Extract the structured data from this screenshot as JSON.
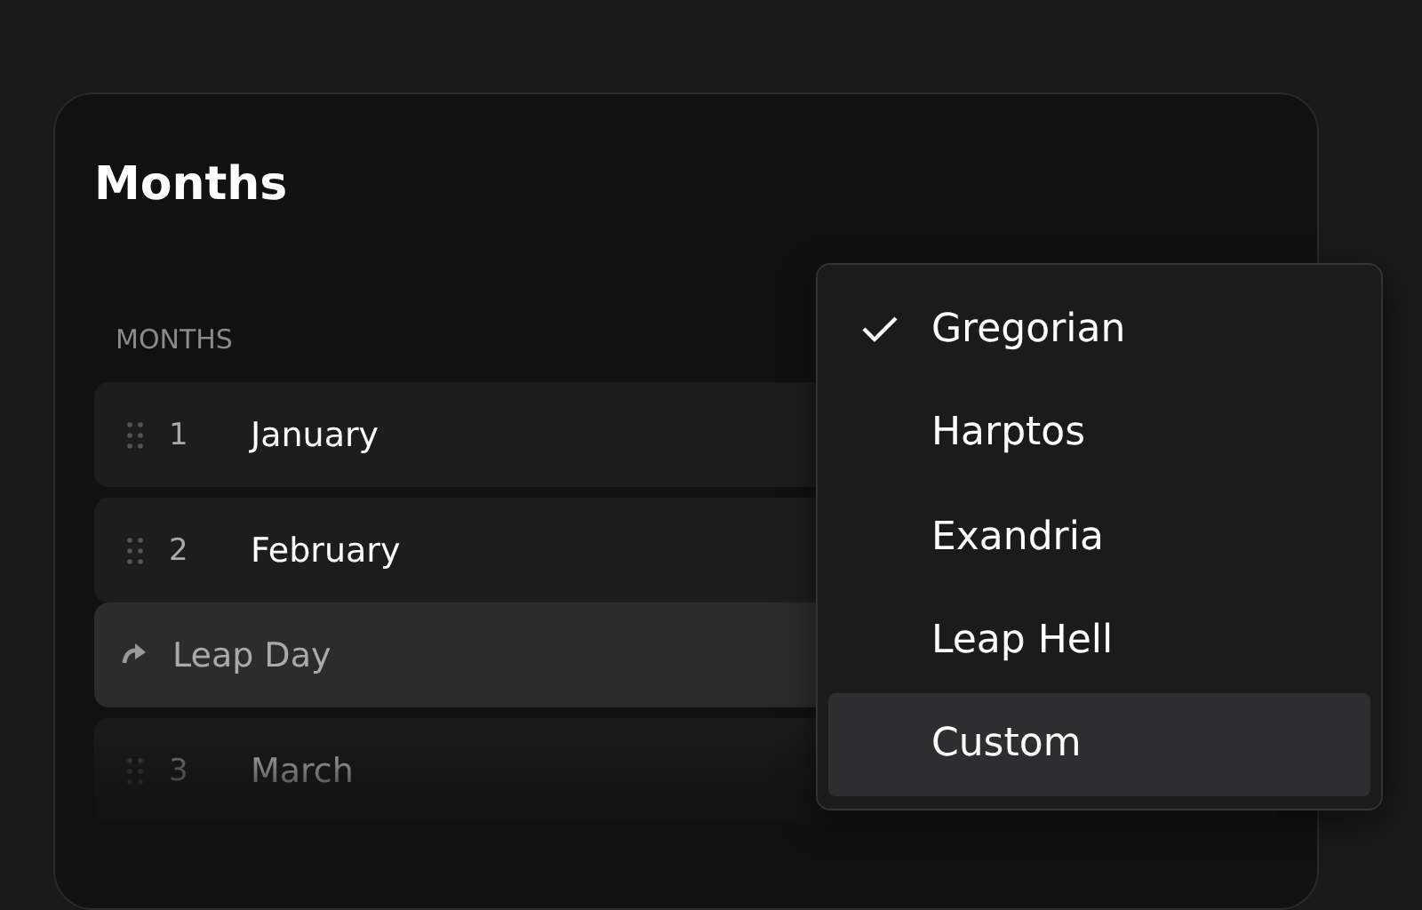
{
  "card": {
    "title": "Months",
    "section_label": "MONTHS",
    "rows": [
      {
        "kind": "month",
        "number": "1",
        "name": "January",
        "highlighted": false
      },
      {
        "kind": "month",
        "number": "2",
        "name": "February",
        "highlighted": false
      },
      {
        "kind": "leap_day",
        "name": "Leap Day",
        "highlighted": true
      },
      {
        "kind": "month",
        "number": "3",
        "name": "March",
        "highlighted": false
      }
    ]
  },
  "menu": {
    "items": [
      {
        "label": "Gregorian",
        "checked": true,
        "highlighted": false
      },
      {
        "label": "Harptos",
        "checked": false,
        "highlighted": false
      },
      {
        "label": "Exandria",
        "checked": false,
        "highlighted": false
      },
      {
        "label": "Leap Hell",
        "checked": false,
        "highlighted": false
      },
      {
        "label": "Custom",
        "checked": false,
        "highlighted": true
      }
    ]
  }
}
